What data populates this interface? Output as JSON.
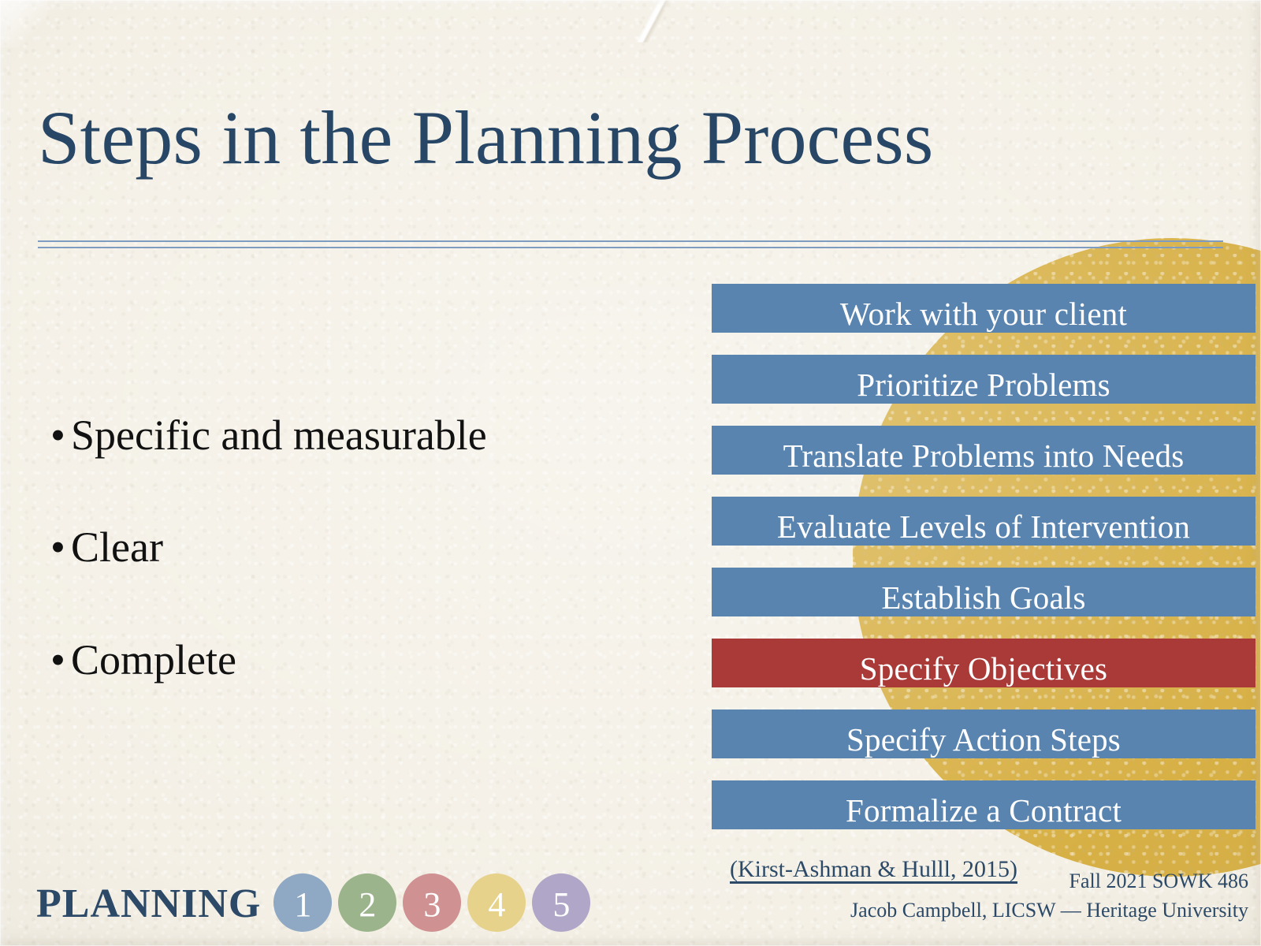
{
  "slide": {
    "title": "Steps in the Planning Process",
    "background_color": "#f4f0e6",
    "accent_navy": "#284766",
    "accent_gold": "#d7b045",
    "accent_blue": "#5a84b0",
    "accent_red": "#a93a38"
  },
  "bullets": [
    {
      "marker": "•",
      "label": "Specific and measurable"
    },
    {
      "marker": "•",
      "label": "Clear"
    },
    {
      "marker": "•",
      "label": "Complete"
    }
  ],
  "steps": [
    {
      "label": "Work with your client",
      "highlighted": false
    },
    {
      "label": "Prioritize Problems",
      "highlighted": false
    },
    {
      "label": "Translate Problems into Needs",
      "highlighted": false
    },
    {
      "label": "Evaluate Levels of Intervention",
      "highlighted": false
    },
    {
      "label": "Establish Goals",
      "highlighted": false
    },
    {
      "label": "Specify Objectives",
      "highlighted": true
    },
    {
      "label": "Specify Action Steps",
      "highlighted": false
    },
    {
      "label": "Formalize a Contract",
      "highlighted": false
    }
  ],
  "footer": {
    "citation": "(Kirst-Ashman & Hulll, 2015)",
    "course": "Fall 2021 SOWK 486",
    "instructor": "Jacob Campbell, LICSW — Heritage University"
  },
  "planning_nav": {
    "label": "PLANNING",
    "circles": [
      {
        "number": "1",
        "color": "#8fa9c4"
      },
      {
        "number": "2",
        "color": "#9bb48c"
      },
      {
        "number": "3",
        "color": "#cf9191"
      },
      {
        "number": "4",
        "color": "#e6d28a"
      },
      {
        "number": "5",
        "color": "#b0a6c7"
      }
    ]
  }
}
